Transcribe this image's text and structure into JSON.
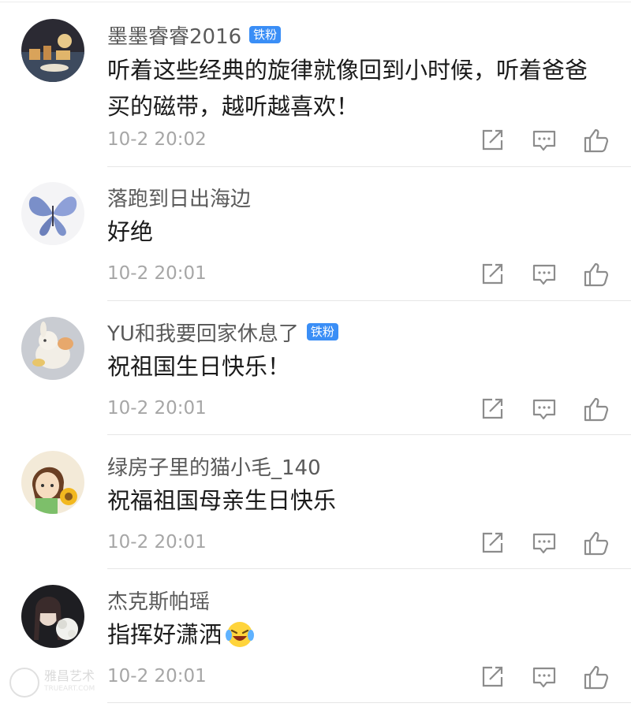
{
  "comments": [
    {
      "username": "墨墨睿睿2016",
      "badge": "铁粉",
      "text": "听着这些经典的旋律就像回到小时候，听着爸爸买的磁带，越听越喜欢！",
      "time": "10-2 20:02"
    },
    {
      "username": "落跑到日出海边",
      "badge": "",
      "text": "好绝",
      "time": "10-2 20:01"
    },
    {
      "username": "YU和我要回家休息了",
      "badge": "铁粉",
      "text": "祝祖国生日快乐！",
      "time": "10-2 20:01"
    },
    {
      "username": "绿房子里的猫小毛_140",
      "badge": "",
      "text": "祝福祖国母亲生日快乐",
      "time": "10-2 20:01"
    },
    {
      "username": "杰克斯帕瑶",
      "badge": "",
      "text": "指挥好潇洒",
      "time": "10-2 20:01"
    }
  ],
  "icons": {
    "share": "share-icon",
    "reply": "comment-icon",
    "like": "thumbs-up-icon",
    "emoji": "laughing-crying-emoji-icon"
  },
  "watermark": {
    "text": "雅昌艺术",
    "sub": "TRUEART.COM"
  },
  "colors": {
    "badge": "#3a8ef6",
    "username": "#5a5a5a",
    "time": "#a6a6a6",
    "icon": "#8c8c8c"
  }
}
